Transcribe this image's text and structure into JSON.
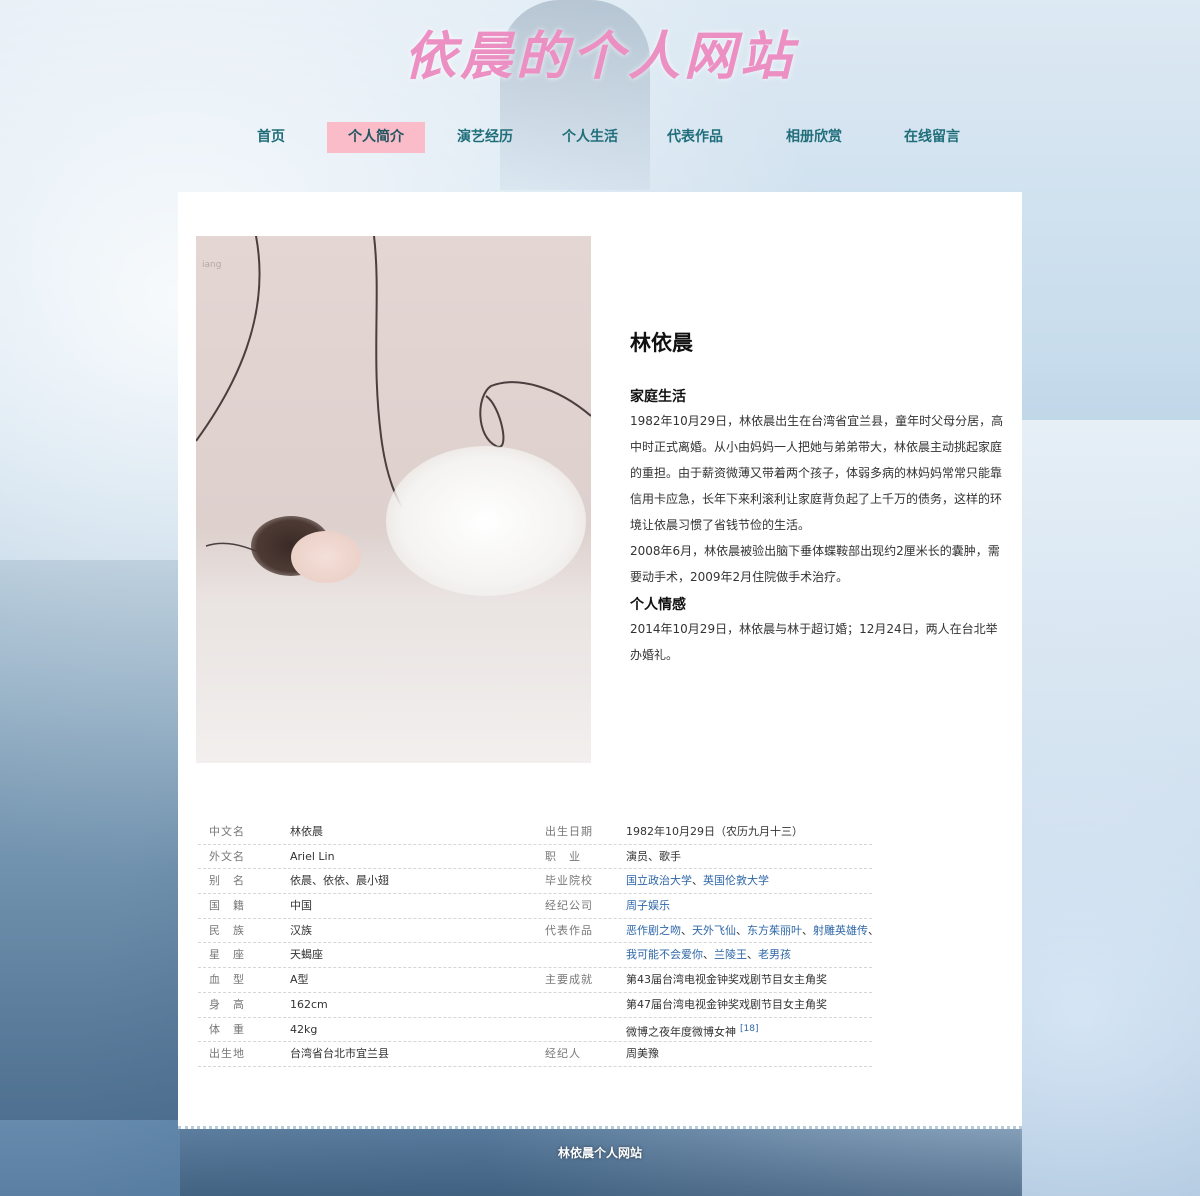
{
  "site_title": "依晨的个人网站",
  "nav": [
    {
      "label": "首页",
      "active": false
    },
    {
      "label": "个人简介",
      "active": true
    },
    {
      "label": "演艺经历",
      "active": false
    },
    {
      "label": "个人生活",
      "active": false
    },
    {
      "label": "代表作品",
      "active": false
    },
    {
      "label": "相册欣赏",
      "active": false
    },
    {
      "label": "在线留言",
      "active": false
    }
  ],
  "photo": {
    "watermark": "iang"
  },
  "intro": {
    "name": "林依晨",
    "sections": [
      {
        "heading": "家庭生活",
        "paragraphs": [
          "1982年10月29日，林依晨出生在台湾省宜兰县，童年时父母分居，高中时正式离婚。从小由妈妈一人把她与弟弟带大，林依晨主动挑起家庭的重担。由于薪资微薄又带着两个孩子，体弱多病的林妈妈常常只能靠信用卡应急，长年下来利滚利让家庭背负起了上千万的债务，这样的环境让依晨习惯了省钱节俭的生活。",
          "2008年6月，林依晨被验出脑下垂体蝶鞍部出现约2厘米长的囊肿，需要动手术，2009年2月住院做手术治疗。"
        ]
      },
      {
        "heading": "个人情感",
        "paragraphs": [
          "2014年10月29日，林依晨与林于超订婚；12月24日，两人在台北举办婚礼。"
        ]
      }
    ]
  },
  "info_table": {
    "rows": [
      {
        "l1": "中文名",
        "v1": "林依晨",
        "l2": "出生日期",
        "v2": "1982年10月29日（农历九月十三）"
      },
      {
        "l1": "外文名",
        "v1": "Ariel Lin",
        "l2": "职　业",
        "v2": "演员、歌手"
      },
      {
        "l1": "别　名",
        "v1": "依晨、依依、晨小翅",
        "l2": "毕业院校",
        "v2_links": [
          "国立政治大学",
          "英国伦敦大学"
        ]
      },
      {
        "l1": "国　籍",
        "v1": "中国",
        "l2": "经纪公司",
        "v2_links": [
          "周子娱乐"
        ]
      },
      {
        "l1": "民　族",
        "v1": "汉族",
        "l2": "代表作品",
        "v2_links": [
          "恶作剧之吻",
          "天外飞仙",
          "东方茱丽叶",
          "射雕英雄传"
        ],
        "v2_trailing": "、"
      },
      {
        "l1": "星　座",
        "v1": "天蝎座",
        "l2": "",
        "v2_links": [
          "我可能不会爱你",
          "兰陵王",
          "老男孩"
        ]
      },
      {
        "l1": "血　型",
        "v1": "A型",
        "l2": "主要成就",
        "v2": "第43届台湾电视金钟奖戏剧节目女主角奖"
      },
      {
        "l1": "身　高",
        "v1": "162cm",
        "l2": "",
        "v2": "第47届台湾电视金钟奖戏剧节目女主角奖"
      },
      {
        "l1": "体　重",
        "v1": "42kg",
        "l2": "",
        "v2": "微博之夜年度微博女神",
        "sup": "[18]"
      },
      {
        "l1": "出生地",
        "v1": "台湾省台北市宜兰县",
        "l2": "经纪人",
        "v2": "周美豫"
      }
    ]
  },
  "footer": "林依晨个人网站"
}
